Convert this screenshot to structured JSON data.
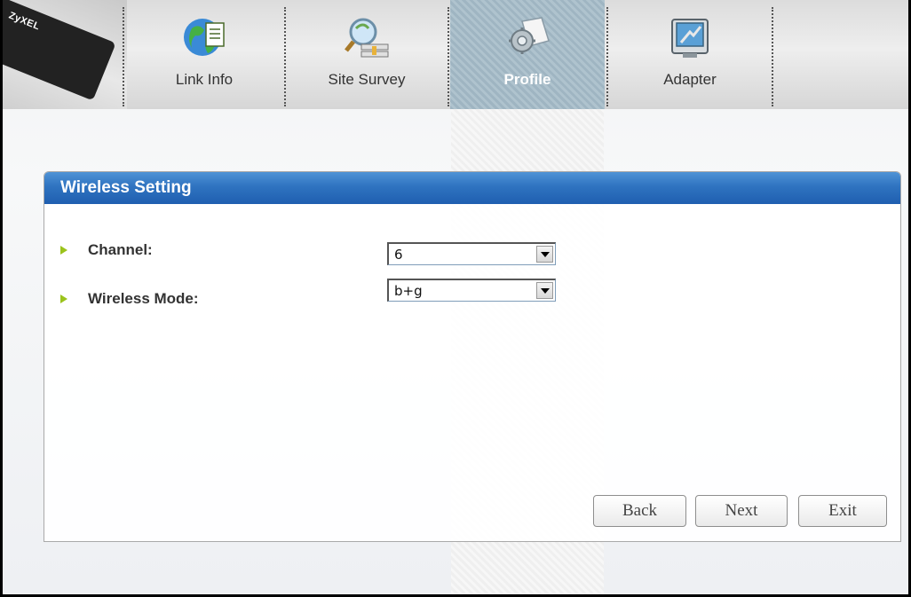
{
  "header": {
    "brand": "ZyXEL",
    "tabs": [
      {
        "label": "Link Info",
        "icon": "globe-document-icon",
        "active": false
      },
      {
        "label": "Site Survey",
        "icon": "magnifier-network-icon",
        "active": false
      },
      {
        "label": "Profile",
        "icon": "gear-document-icon",
        "active": true
      },
      {
        "label": "Adapter",
        "icon": "adapter-screen-icon",
        "active": false
      }
    ]
  },
  "panel": {
    "title": "Wireless Setting",
    "fields": [
      {
        "label": "Channel:",
        "value": "6"
      },
      {
        "label": "Wireless Mode:",
        "value": "b+g"
      }
    ]
  },
  "buttons": {
    "back": "Back",
    "next": "Next",
    "exit": "Exit"
  },
  "colors": {
    "accent_blue": "#2f73c0",
    "bullet_green": "#9bc31c",
    "active_tab": "#9fb5c2"
  }
}
